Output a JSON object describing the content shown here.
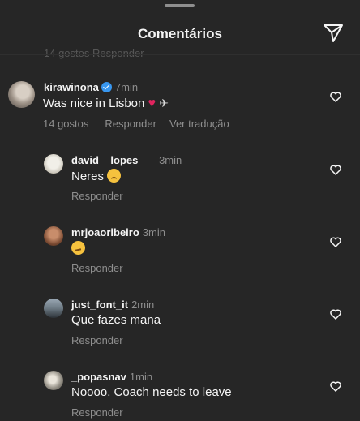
{
  "header": {
    "title": "Comentários"
  },
  "ghost_row": "14 gostos   Responder",
  "comments": [
    {
      "username": "kirawinona",
      "time": "7min",
      "text": "Was nice in Lisbon",
      "likes": "14 gostos",
      "reply": "Responder",
      "translate": "Ver tradução"
    },
    {
      "username": "david__lopes___",
      "time": "3min",
      "text": "Neres",
      "reply": "Responder"
    },
    {
      "username": "mrjoaoribeiro",
      "time": "3min",
      "text": "",
      "reply": "Responder"
    },
    {
      "username": "just_font_it",
      "time": "2min",
      "text": "Que fazes mana",
      "reply": "Responder"
    },
    {
      "username": "_popasnav",
      "time": "1min",
      "text": "Noooo. Coach needs to leave",
      "reply": "Responder"
    }
  ],
  "colors": {
    "background": "#262626",
    "verified": "#3897f0",
    "heart_red": "#e0245e"
  }
}
